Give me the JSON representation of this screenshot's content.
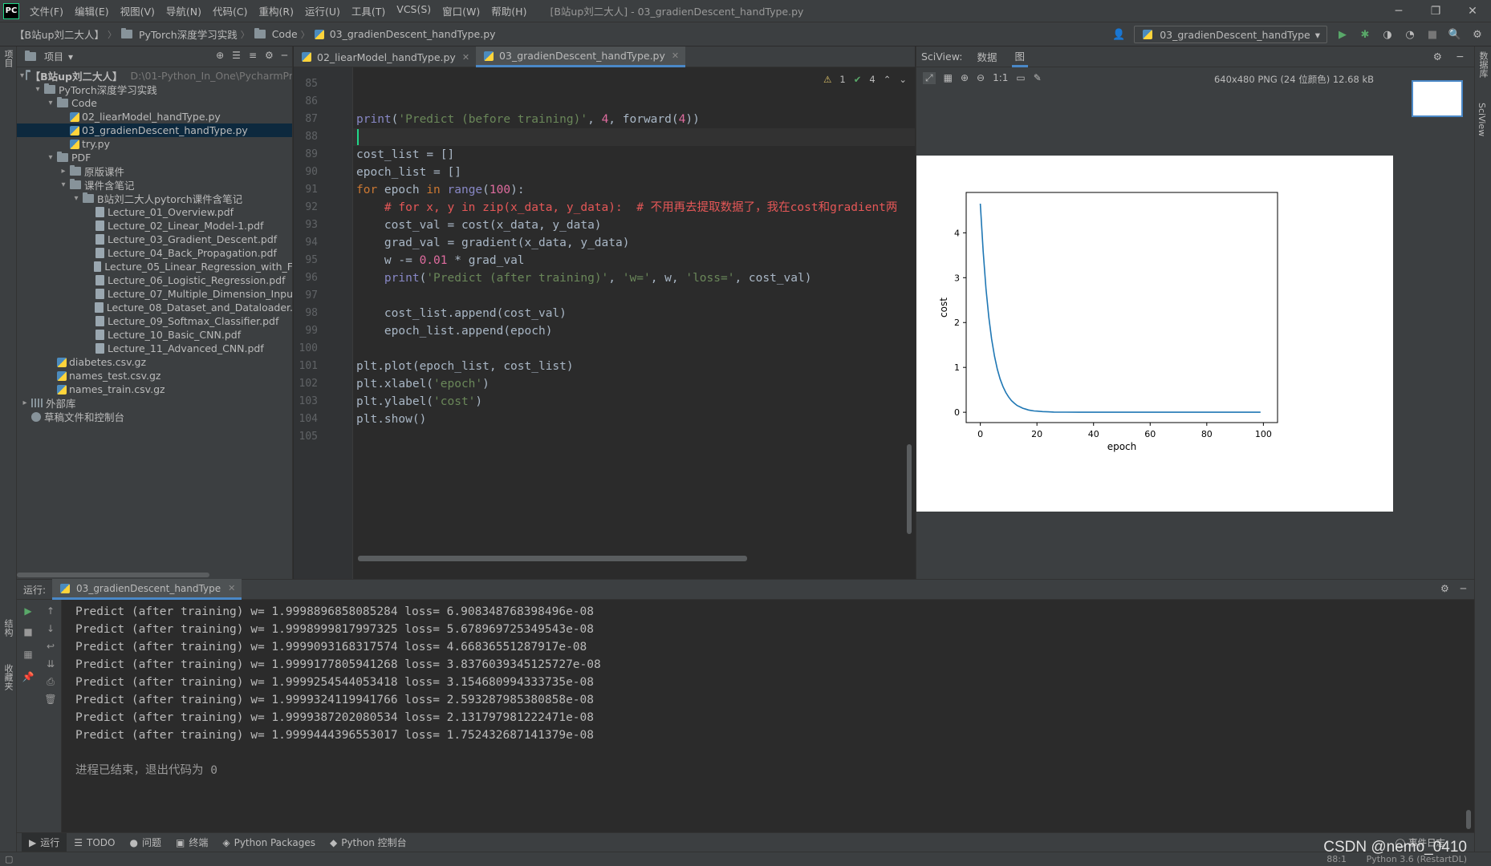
{
  "menubar": {
    "logo": "PC",
    "items": [
      "文件(F)",
      "编辑(E)",
      "视图(V)",
      "导航(N)",
      "代码(C)",
      "重构(R)",
      "运行(U)",
      "工具(T)",
      "VCS(S)",
      "窗口(W)",
      "帮助(H)"
    ],
    "window_title": "[B站up刘二大人] - 03_gradienDescent_handType.py"
  },
  "navbar": {
    "crumbs": [
      "【B站up刘二大人】",
      "PyTorch深度学习实践",
      "Code",
      "03_gradienDescent_handType.py"
    ],
    "run_config": "03_gradienDescent_handType"
  },
  "left_strip": {
    "project_tab": "项目",
    "structure_tab": "结构",
    "favorites_tab": "收藏夹"
  },
  "right_strip": {
    "database_tab": "数据库",
    "sciview_tab": "SciView"
  },
  "project": {
    "header": "项目",
    "tree": [
      {
        "label": "【B站up刘二大人】",
        "hint": "D:\\01-Python_In_One\\PycharmPr",
        "kind": "folder",
        "arrow": "▾",
        "indent": 0
      },
      {
        "label": "PyTorch深度学习实践",
        "kind": "folder",
        "arrow": "▾",
        "indent": 1
      },
      {
        "label": "Code",
        "kind": "folder",
        "arrow": "▾",
        "indent": 2
      },
      {
        "label": "02_liearModel_handType.py",
        "kind": "py",
        "arrow": "",
        "indent": 3
      },
      {
        "label": "03_gradienDescent_handType.py",
        "kind": "py",
        "arrow": "",
        "indent": 3,
        "selected": true
      },
      {
        "label": "try.py",
        "kind": "py",
        "arrow": "",
        "indent": 3
      },
      {
        "label": "PDF",
        "kind": "folder",
        "arrow": "▾",
        "indent": 2
      },
      {
        "label": "原版课件",
        "kind": "folder",
        "arrow": "▸",
        "indent": 3
      },
      {
        "label": "课件含笔记",
        "kind": "folder",
        "arrow": "▾",
        "indent": 3
      },
      {
        "label": "B站刘二大人pytorch课件含笔记",
        "kind": "folder",
        "arrow": "▾",
        "indent": 4
      },
      {
        "label": "Lecture_01_Overview.pdf",
        "kind": "pdf",
        "arrow": "",
        "indent": 5
      },
      {
        "label": "Lecture_02_Linear_Model-1.pdf",
        "kind": "pdf",
        "arrow": "",
        "indent": 5
      },
      {
        "label": "Lecture_03_Gradient_Descent.pdf",
        "kind": "pdf",
        "arrow": "",
        "indent": 5
      },
      {
        "label": "Lecture_04_Back_Propagation.pdf",
        "kind": "pdf",
        "arrow": "",
        "indent": 5
      },
      {
        "label": "Lecture_05_Linear_Regression_with_F",
        "kind": "pdf",
        "arrow": "",
        "indent": 5
      },
      {
        "label": "Lecture_06_Logistic_Regression.pdf",
        "kind": "pdf",
        "arrow": "",
        "indent": 5
      },
      {
        "label": "Lecture_07_Multiple_Dimension_Inpu",
        "kind": "pdf",
        "arrow": "",
        "indent": 5
      },
      {
        "label": "Lecture_08_Dataset_and_Dataloader.",
        "kind": "pdf",
        "arrow": "",
        "indent": 5
      },
      {
        "label": "Lecture_09_Softmax_Classifier.pdf",
        "kind": "pdf",
        "arrow": "",
        "indent": 5
      },
      {
        "label": "Lecture_10_Basic_CNN.pdf",
        "kind": "pdf",
        "arrow": "",
        "indent": 5
      },
      {
        "label": "Lecture_11_Advanced_CNN.pdf",
        "kind": "pdf",
        "arrow": "",
        "indent": 5
      },
      {
        "label": "diabetes.csv.gz",
        "kind": "py",
        "arrow": "",
        "indent": 2
      },
      {
        "label": "names_test.csv.gz",
        "kind": "py",
        "arrow": "",
        "indent": 2
      },
      {
        "label": "names_train.csv.gz",
        "kind": "py",
        "arrow": "",
        "indent": 2
      },
      {
        "label": "外部库",
        "kind": "lib",
        "arrow": "▸",
        "indent": 0
      },
      {
        "label": "草稿文件和控制台",
        "kind": "scratch",
        "arrow": "",
        "indent": 0
      }
    ]
  },
  "editor": {
    "tabs": [
      {
        "label": "02_liearModel_handType.py",
        "active": false
      },
      {
        "label": "03_gradienDescent_handType.py",
        "active": true
      }
    ],
    "status": {
      "warnings": "1",
      "checks": "4"
    },
    "line_numbers": [
      "85",
      "86",
      "87",
      "88",
      "89",
      "90",
      "91",
      "92",
      "93",
      "94",
      "95",
      "96",
      "97",
      "98",
      "99",
      "100",
      "101",
      "102",
      "103",
      "104",
      "105"
    ],
    "current_line_index": 3,
    "lines": [
      [],
      [],
      [
        [
          "fn",
          "print"
        ],
        [
          "",
          "("
        ],
        [
          "str",
          "'Predict (before training)'"
        ],
        [
          "",
          ", "
        ],
        [
          "pink",
          "4"
        ],
        [
          "",
          ", "
        ],
        [
          "",
          "forward("
        ],
        [
          "pink",
          "4"
        ],
        [
          "",
          "))"
        ]
      ],
      [],
      [
        [
          "",
          "cost_list "
        ],
        [
          "",
          "= []"
        ]
      ],
      [
        [
          "",
          "epoch_list "
        ],
        [
          "",
          "= []"
        ]
      ],
      [
        [
          "kw",
          "for "
        ],
        [
          "",
          "epoch "
        ],
        [
          "kw",
          "in "
        ],
        [
          "fn",
          "range"
        ],
        [
          "",
          "("
        ],
        [
          "pink",
          "100"
        ],
        [
          "",
          "):"
        ]
      ],
      [
        [
          "cmt-red",
          "    # for x, y in zip(x_data, y_data):  # 不用再去提取数据了，我在cost和gradient两"
        ]
      ],
      [
        [
          "",
          "    cost_val = cost(x_data, y_data)"
        ]
      ],
      [
        [
          "",
          "    grad_val = gradient(x_data, y_data)"
        ]
      ],
      [
        [
          "",
          "    w -= "
        ],
        [
          "pink",
          "0.01"
        ],
        [
          "",
          " * grad_val"
        ]
      ],
      [
        [
          "fn",
          "    print"
        ],
        [
          "",
          "("
        ],
        [
          "str",
          "'Predict (after training)'"
        ],
        [
          "",
          ", "
        ],
        [
          "str",
          "'w='"
        ],
        [
          "",
          ", w, "
        ],
        [
          "str",
          "'loss='"
        ],
        [
          "",
          ", cost_val)"
        ]
      ],
      [],
      [
        [
          "",
          "    cost_list.append(cost_val)"
        ]
      ],
      [
        [
          "",
          "    epoch_list.append(epoch)"
        ]
      ],
      [],
      [
        [
          "",
          "plt.plot(epoch_list, cost_list)"
        ]
      ],
      [
        [
          "",
          "plt.xlabel("
        ],
        [
          "str",
          "'epoch'"
        ],
        [
          "",
          ")"
        ]
      ],
      [
        [
          "",
          "plt.ylabel("
        ],
        [
          "str",
          "'cost'"
        ],
        [
          "",
          ")"
        ]
      ],
      [
        [
          "",
          "plt.show()"
        ]
      ],
      []
    ]
  },
  "sciview": {
    "label": "SciView:",
    "tab_data": "数据",
    "tab_plots": "图",
    "zoom_label": "1:1",
    "image_info": "640x480 PNG (24 位颜色) 12.68 kB"
  },
  "chart_data": {
    "type": "line",
    "xlabel": "epoch",
    "ylabel": "cost",
    "xlim": [
      -5,
      105
    ],
    "ylim": [
      -0.23,
      4.9
    ],
    "xticks": [
      0,
      20,
      40,
      60,
      80,
      100
    ],
    "yticks": [
      0,
      1,
      2,
      3,
      4
    ],
    "grid": false,
    "line_color": "#1f77b4",
    "series": [
      {
        "x": [
          0,
          1,
          2,
          3,
          4,
          5,
          6,
          7,
          8,
          9,
          10,
          11,
          12,
          13,
          14,
          15,
          16,
          17,
          18,
          19,
          20,
          22,
          24,
          26,
          28,
          30,
          35,
          40,
          45,
          50,
          60,
          70,
          80,
          90,
          99
        ],
        "values": [
          4.65,
          3.58,
          2.75,
          2.12,
          1.63,
          1.25,
          0.96,
          0.74,
          0.57,
          0.44,
          0.34,
          0.26,
          0.2,
          0.15,
          0.12,
          0.09,
          0.07,
          0.05,
          0.04,
          0.03,
          0.025,
          0.015,
          0.009,
          0.005,
          0.003,
          0.002,
          0.0005,
          0.0001,
          0,
          0,
          0,
          0,
          0,
          0,
          0
        ]
      }
    ]
  },
  "run": {
    "label": "运行:",
    "tab": "03_gradienDescent_handType",
    "output": [
      "Predict (after training) w= 1.9998896858085284 loss= 6.908348768398496e-08",
      "Predict (after training) w= 1.9998999817997325 loss= 5.678969725349543e-08",
      "Predict (after training) w= 1.9999093168317574 loss= 4.66836551287917e-08",
      "Predict (after training) w= 1.9999177805941268 loss= 3.8376039345125727e-08",
      "Predict (after training) w= 1.9999254544053418 loss= 3.154680994333735e-08",
      "Predict (after training) w= 1.9999324119941766 loss= 2.593287985380858e-08",
      "Predict (after training) w= 1.9999387202080534 loss= 2.131797981222471e-08",
      "Predict (after training) w= 1.9999444396553017 loss= 1.752432687141379e-08",
      "",
      "进程已结束，退出代码为 0"
    ]
  },
  "bottom_bar": {
    "tabs": [
      "运行",
      "TODO",
      "问题",
      "终端",
      "Python Packages",
      "Python 控制台"
    ],
    "event_log": "事件日志"
  },
  "status_bar": {
    "position": "88:1",
    "interpreter": "Python 3.6 (RestartDL)"
  },
  "watermark": "CSDN @nemo_0410"
}
